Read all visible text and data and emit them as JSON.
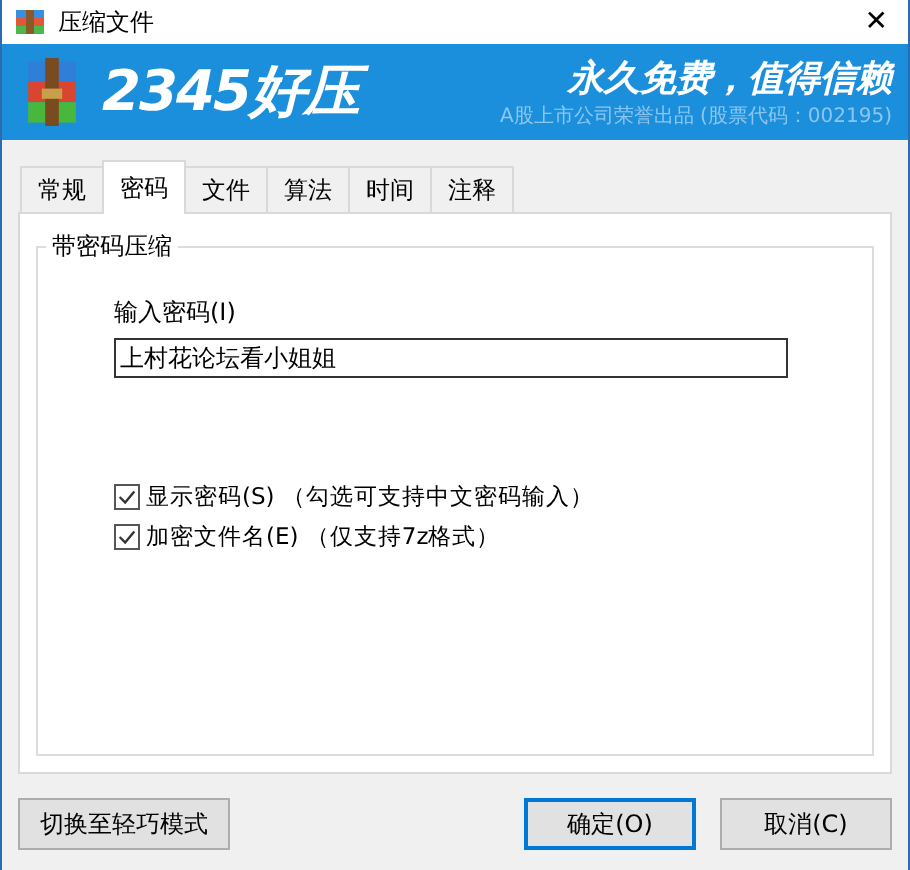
{
  "window": {
    "title": "压缩文件",
    "close": "✕"
  },
  "banner": {
    "logo": "2345好压",
    "slogan": "永久免费，值得信赖",
    "subtitle": "A股上市公司荣誉出品 (股票代码：002195)"
  },
  "tabs": [
    {
      "label": "常规",
      "selected": false
    },
    {
      "label": "密码",
      "selected": true
    },
    {
      "label": "文件",
      "selected": false
    },
    {
      "label": "算法",
      "selected": false
    },
    {
      "label": "时间",
      "selected": false
    },
    {
      "label": "注释",
      "selected": false
    }
  ],
  "group": {
    "title": "带密码压缩",
    "field_label": "输入密码(I)",
    "password": "上村花论坛看小姐姐",
    "options": [
      {
        "label": "显示密码(S) （勾选可支持中文密码输入）",
        "checked": true
      },
      {
        "label": "加密文件名(E) （仅支持7z格式）",
        "checked": true
      }
    ]
  },
  "buttons": {
    "mode": "切换至轻巧模式",
    "ok": "确定(O)",
    "cancel": "取消(C)"
  }
}
